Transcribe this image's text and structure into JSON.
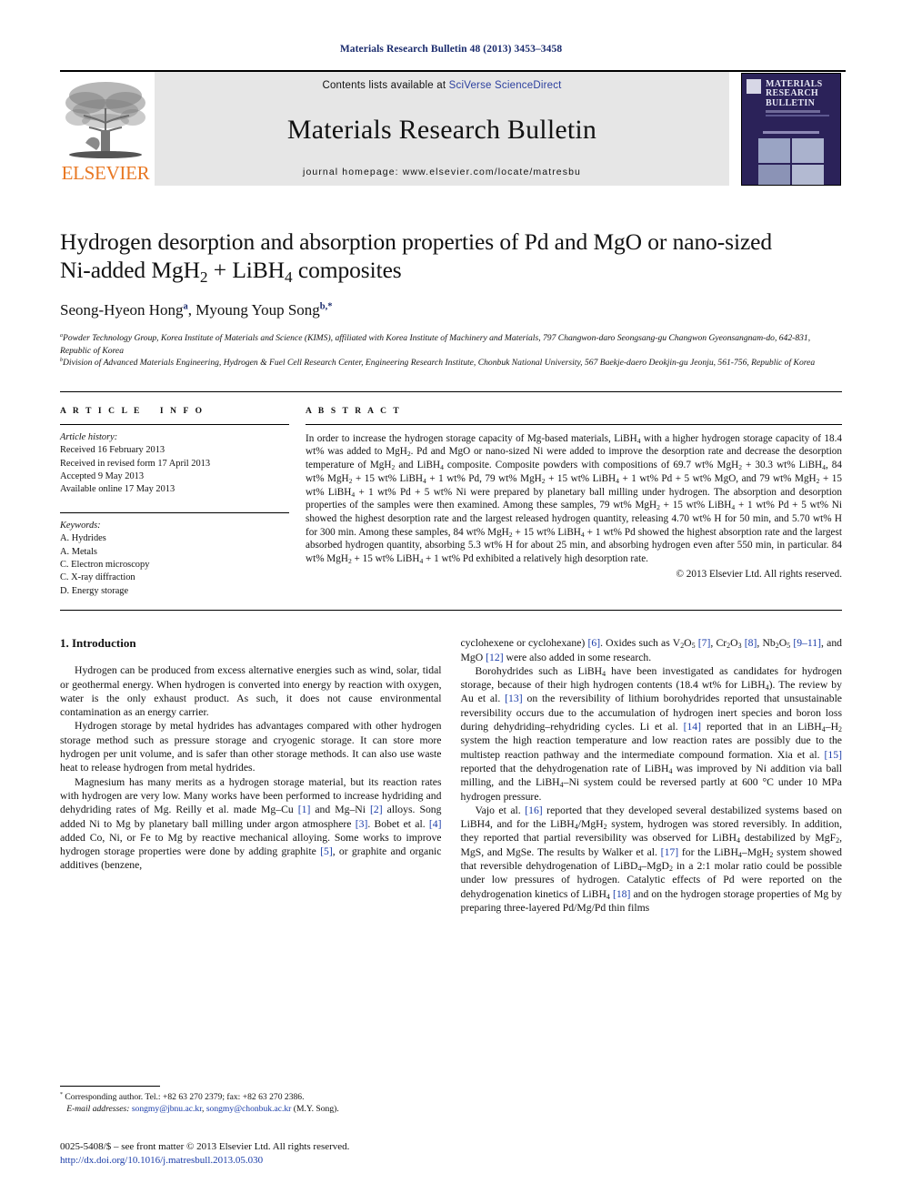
{
  "running_head": "Materials Research Bulletin 48 (2013) 3453–3458",
  "masthead": {
    "contents_prefix": "Contents lists available at ",
    "contents_link": "SciVerse ScienceDirect",
    "journal_name": "Materials Research Bulletin",
    "homepage": "journal homepage: www.elsevier.com/locate/matresbu",
    "publisher": "ELSEVIER",
    "cover_title_line1": "MATERIALS",
    "cover_title_line2": "RESEARCH",
    "cover_title_line3": "BULLETIN"
  },
  "title": {
    "line1": "Hydrogen desorption and absorption properties of Pd and MgO or nano-sized",
    "line2_a": "Ni-added MgH",
    "line2_sub1": "2",
    "line2_b": " + LiBH",
    "line2_sub2": "4",
    "line2_c": " composites"
  },
  "authors": {
    "a1_name": "Seong-Hyeon Hong",
    "a1_mark": "a",
    "sep": ", ",
    "a2_name": "Myoung Youp Song",
    "a2_mark": "b,*"
  },
  "affiliations": [
    {
      "mark": "a",
      "text": "Powder Technology Group, Korea Institute of Materials and Science (KIMS), affiliated with Korea Institute of Machinery and Materials, 797 Changwon-daro Seongsang-gu Changwon Gyeonsangnam-do, 642-831, Republic of Korea"
    },
    {
      "mark": "b",
      "text": "Division of Advanced Materials Engineering, Hydrogen & Fuel Cell Research Center, Engineering Research Institute, Chonbuk National University, 567 Baekje-daero Deokjin-gu Jeonju, 561-756, Republic of Korea"
    }
  ],
  "article_info": {
    "heading": "ARTICLE INFO",
    "history_label": "Article history:",
    "history": [
      "Received 16 February 2013",
      "Received in revised form 17 April 2013",
      "Accepted 9 May 2013",
      "Available online 17 May 2013"
    ],
    "keywords_label": "Keywords:",
    "keywords": [
      "A. Hydrides",
      "A. Metals",
      "C. Electron microscopy",
      "C. X-ray diffraction",
      "D. Energy storage"
    ]
  },
  "abstract": {
    "heading": "ABSTRACT",
    "copyright": "© 2013 Elsevier Ltd. All rights reserved."
  },
  "body": {
    "section1_heading": "1. Introduction",
    "footnote_corresponding": "Corresponding author. Tel.: +82 63 270 2379; fax: +82 63 270 2386.",
    "footnote_email_label": "E-mail addresses:",
    "footnote_email1": "songmy@jbnu.ac.kr",
    "footnote_email2": "songmy@chonbuk.ac.kr",
    "footnote_email_suffix": "(M.Y. Song).",
    "imprint": "0025-5408/$ – see front matter © 2013 Elsevier Ltd. All rights reserved.",
    "doi": "http://dx.doi.org/10.1016/j.matresbull.2013.05.030"
  },
  "colors": {
    "link": "#1a3ca8",
    "running_head": "#1a2b6d",
    "elsevier_orange": "#e87722",
    "cover_navy": "#2b2259",
    "masthead_grey": "#e6e6e6"
  }
}
